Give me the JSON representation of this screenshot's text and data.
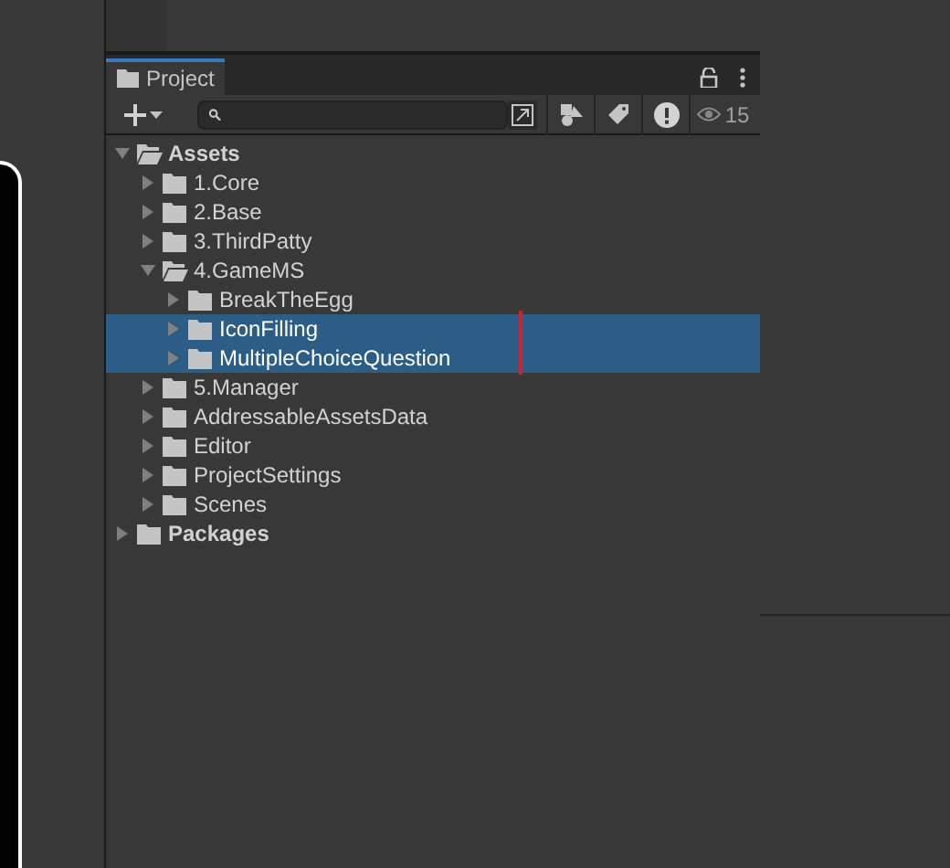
{
  "panel": {
    "tab": {
      "label": "Project",
      "selected": true
    },
    "hidden_count": "15"
  },
  "tree": [
    {
      "label": "Assets",
      "bold": true,
      "expanded": true,
      "selected": false,
      "children": [
        {
          "label": "1.Core",
          "expanded": false,
          "selected": false
        },
        {
          "label": "2.Base",
          "expanded": false,
          "selected": false
        },
        {
          "label": "3.ThirdPatty",
          "expanded": false,
          "selected": false
        },
        {
          "label": "4.GameMS",
          "expanded": true,
          "selected": false,
          "children": [
            {
              "label": "BreakTheEgg",
              "expanded": false,
              "selected": false
            },
            {
              "label": "IconFilling",
              "expanded": false,
              "selected": true
            },
            {
              "label": "MultipleChoiceQuestion",
              "expanded": false,
              "selected": true
            }
          ]
        },
        {
          "label": "5.Manager",
          "expanded": false,
          "selected": false
        },
        {
          "label": "AddressableAssetsData",
          "expanded": false,
          "selected": false
        },
        {
          "label": "Editor",
          "expanded": false,
          "selected": false
        },
        {
          "label": "ProjectSettings",
          "expanded": false,
          "selected": false
        },
        {
          "label": "Scenes",
          "expanded": false,
          "selected": false
        }
      ]
    },
    {
      "label": "Packages",
      "bold": true,
      "expanded": false,
      "selected": false
    }
  ]
}
